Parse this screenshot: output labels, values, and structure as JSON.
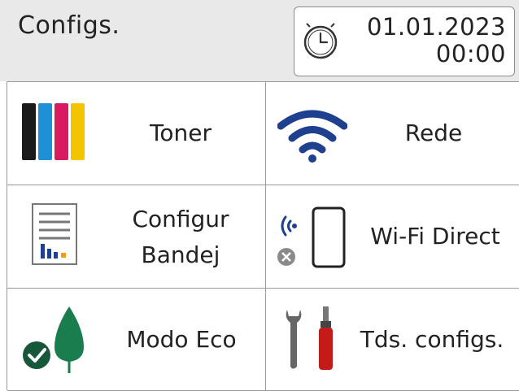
{
  "header": {
    "title": "Configs.",
    "date": "01.01.2023",
    "time": "00:00",
    "clock_icon": "clock-icon"
  },
  "tiles": [
    {
      "label": "Toner",
      "icon": "toner-cartridges-icon"
    },
    {
      "label": "Rede",
      "icon": "wifi-icon"
    },
    {
      "label_line1": "Configur",
      "label_line2": "Bandej",
      "icon": "tray-settings-icon"
    },
    {
      "label": "Wi-Fi Direct",
      "icon": "wifi-direct-phone-icon",
      "status": "disabled"
    },
    {
      "label": "Modo Eco",
      "icon": "eco-leaf-icon",
      "status": "enabled"
    },
    {
      "label": "Tds. configs.",
      "icon": "tools-icon"
    }
  ],
  "colors": {
    "header_bg": "#e9e9e9",
    "wifi_blue": "#1f3f8f",
    "eco_green": "#1a7d4e",
    "check_green": "#17573a",
    "disabled_grey": "#8a8a8a",
    "toner_black": "#1a1a1a",
    "toner_cyan": "#1e90d6",
    "toner_magenta": "#d81b60",
    "toner_yellow": "#f5c400",
    "tool_red": "#c41a1a"
  }
}
